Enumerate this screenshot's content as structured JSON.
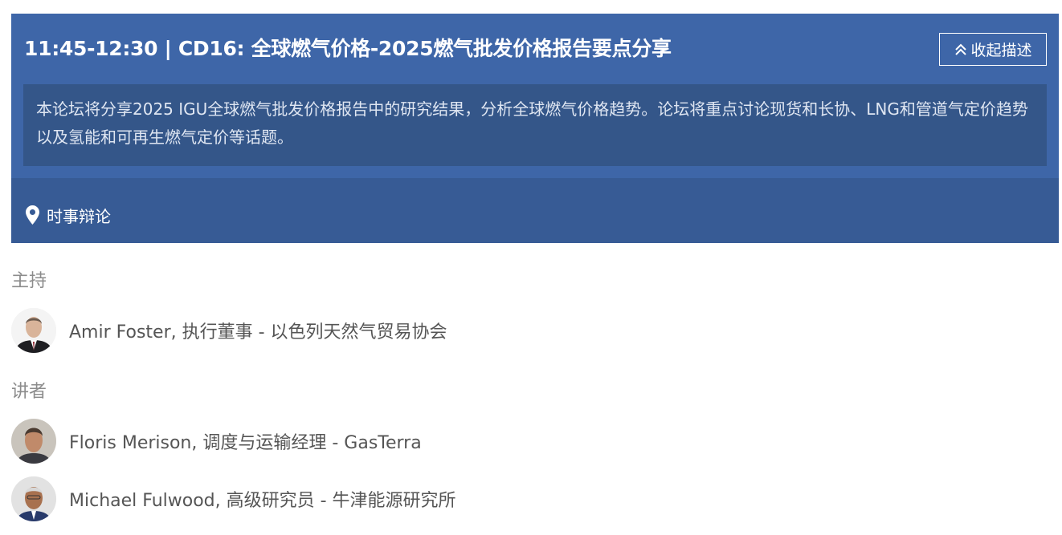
{
  "session": {
    "title": "11:45-12:30 | CD16: 全球燃气价格-2025燃气批发价格报告要点分享",
    "collapse_label": "收起描述",
    "description": "本论坛将分享2025 IGU全球燃气批发价格报告中的研究结果，分析全球燃气价格趋势。论坛将重点讨论现货和长协、LNG和管道气定价趋势以及氢能和可再生燃气定价等话题。",
    "location": "时事辩论"
  },
  "moderators": {
    "heading": "主持",
    "people": [
      {
        "name": "Amir Foster, 执行董事 - 以色列天然气贸易协会"
      }
    ]
  },
  "speakers": {
    "heading": "讲者",
    "people": [
      {
        "name": "Floris Merison, 调度与运输经理 - GasTerra"
      },
      {
        "name": "Michael Fulwood, 高级研究员 - 牛津能源研究所"
      }
    ]
  },
  "colors": {
    "card_bg": "#3e66a8",
    "description_bg": "#345689",
    "location_bg": "#375b95",
    "heading_text": "#8c8c8c",
    "person_text": "#555555"
  }
}
